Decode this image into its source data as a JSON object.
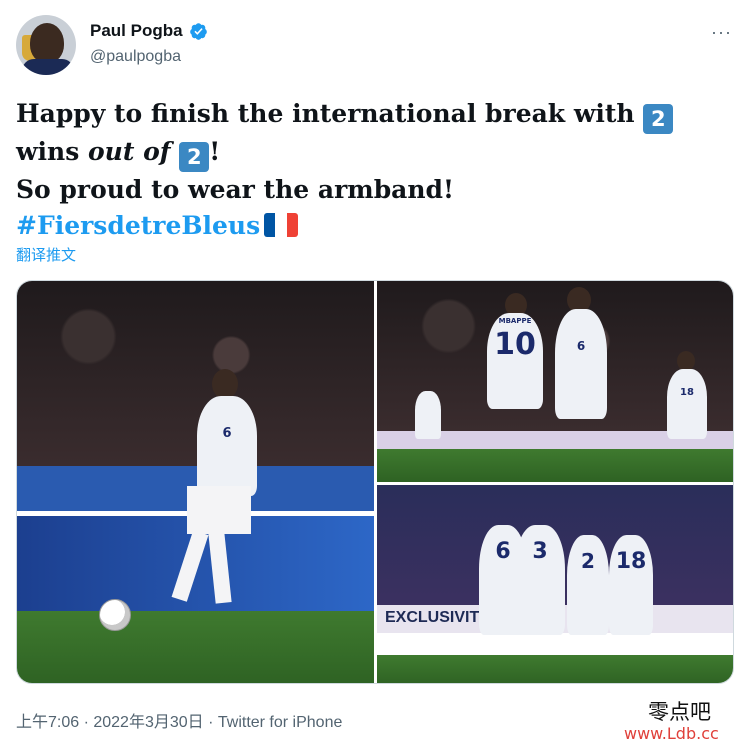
{
  "author": {
    "display_name": "Paul Pogba",
    "handle": "@paulpogba",
    "verified_icon": "verified-badge-icon",
    "avatar_icon": "avatar-photo"
  },
  "more_label": "···",
  "tweet": {
    "line1": "Happy to finish the international break with ",
    "keycap1": "2",
    "line2_a": "wins ",
    "line2_italic": "out of",
    "line2_b": " ",
    "keycap2": "2",
    "line2_c": "!",
    "line3": "So proud to wear the armband!",
    "hashtag": "#FiersdetreBleus",
    "flag_colors": [
      "#0055a4",
      "#ffffff",
      "#ef4135"
    ]
  },
  "translate_label": "翻译推文",
  "media": {
    "photo2_jerseys": [
      "10",
      "6",
      "18"
    ],
    "photo2_name": "MBAPPE",
    "photo1_jersey": "6",
    "photo3_jerseys": [
      "6",
      "3",
      "2",
      "18"
    ],
    "photo3_banner": "EXCLUSIVITÉ"
  },
  "meta": "上午7:06 · 2022年3月30日 · Twitter for iPhone",
  "watermark": {
    "cn": "零点吧",
    "url": "www.Ldb.cc"
  },
  "colors": {
    "accent": "#1d9bf0",
    "secondary_text": "#536471",
    "keycap": "#3b88c3"
  }
}
